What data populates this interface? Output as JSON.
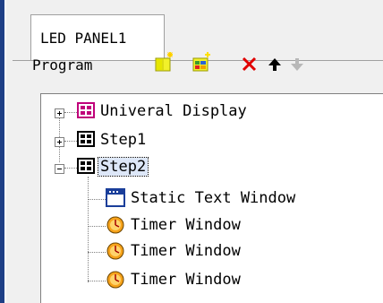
{
  "tab": {
    "label": "LED PANEL1"
  },
  "program": {
    "label": "Program",
    "toolbar": {
      "new_program_icon": "new-program-icon",
      "new_window_icon": "new-window-icon",
      "delete_icon": "delete-icon",
      "move_up_icon": "arrow-up-icon",
      "move_down_icon": "arrow-down-icon"
    }
  },
  "tree": {
    "nodes": [
      {
        "label": "Univeral Display",
        "icon": "program-icon",
        "expanded": false
      },
      {
        "label": "Step1",
        "icon": "program-icon",
        "expanded": false
      },
      {
        "label": "Step2",
        "icon": "program-icon",
        "expanded": true,
        "selected": true,
        "children": [
          {
            "label": "Static Text Window",
            "icon": "text-window-icon"
          },
          {
            "label": "Timer Window",
            "icon": "timer-icon"
          },
          {
            "label": "Timer Window",
            "icon": "timer-icon"
          },
          {
            "label": "Timer Window",
            "icon": "timer-icon"
          }
        ]
      }
    ]
  },
  "colors": {
    "frame_blue": "#1e3f86",
    "delete_red": "#e00000",
    "timer_orange": "#f6a21a",
    "program_icon_pink": "#c0007a"
  }
}
